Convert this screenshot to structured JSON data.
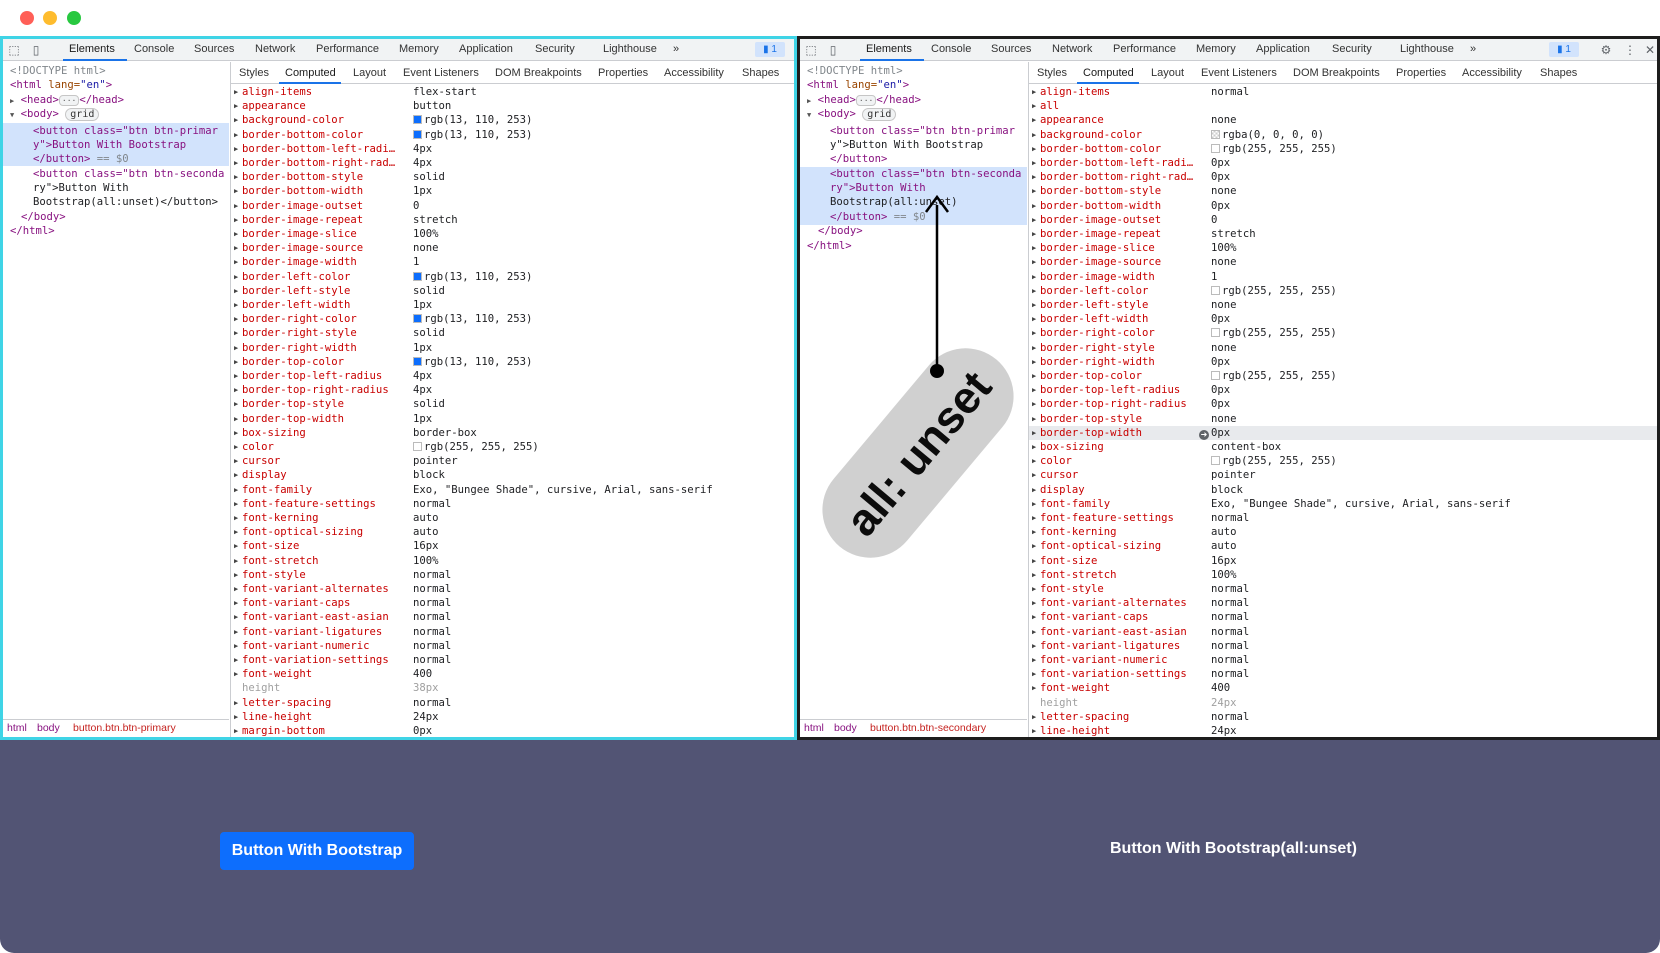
{
  "devtools_left": {
    "main_tabs": [
      "Elements",
      "Console",
      "Sources",
      "Network",
      "Performance",
      "Memory",
      "Application",
      "Security",
      "Lighthouse"
    ],
    "more_tabs": "»",
    "issues_count": "1",
    "dom": {
      "doctype": "<!DOCTYPE html>",
      "html_open_tag": "<html",
      "html_lang_attr": " lang=",
      "html_lang_val": "\"en\"",
      "html_open_close": ">",
      "head_open": "<head>",
      "head_ellipsis": "···",
      "head_close": "</head>",
      "body_open": "<body>",
      "body_badge": "grid",
      "button1_line1": "<button class=\"btn btn-primar",
      "button1_line2": "y\">Button With Bootstrap",
      "button1_line3": "</button>",
      "button1_eq": "== $0",
      "button2_line1": "<button class=\"btn btn-seconda",
      "button2_line2": "ry\">Button With",
      "button2_line3": "Bootstrap(all:unset)</button>",
      "body_close": "</body>",
      "html_close": "</html>"
    },
    "breadcrumbs": [
      "html",
      "body",
      "button.btn.btn-primary"
    ],
    "sub_tabs": [
      "Styles",
      "Computed",
      "Layout",
      "Event Listeners",
      "DOM Breakpoints",
      "Properties",
      "Accessibility",
      "Shapes"
    ],
    "active_sub_tab": "Computed",
    "computed": [
      {
        "name": "align-items",
        "value": "flex-start"
      },
      {
        "name": "appearance",
        "value": "button"
      },
      {
        "name": "background-color",
        "value": "rgb(13, 110, 253)",
        "swatch": "#0d6efd"
      },
      {
        "name": "border-bottom-color",
        "value": "rgb(13, 110, 253)",
        "swatch": "#0d6efd"
      },
      {
        "name": "border-bottom-left-radi…",
        "value": "4px"
      },
      {
        "name": "border-bottom-right-rad…",
        "value": "4px"
      },
      {
        "name": "border-bottom-style",
        "value": "solid"
      },
      {
        "name": "border-bottom-width",
        "value": "1px"
      },
      {
        "name": "border-image-outset",
        "value": "0"
      },
      {
        "name": "border-image-repeat",
        "value": "stretch"
      },
      {
        "name": "border-image-slice",
        "value": "100%"
      },
      {
        "name": "border-image-source",
        "value": "none"
      },
      {
        "name": "border-image-width",
        "value": "1"
      },
      {
        "name": "border-left-color",
        "value": "rgb(13, 110, 253)",
        "swatch": "#0d6efd"
      },
      {
        "name": "border-left-style",
        "value": "solid"
      },
      {
        "name": "border-left-width",
        "value": "1px"
      },
      {
        "name": "border-right-color",
        "value": "rgb(13, 110, 253)",
        "swatch": "#0d6efd"
      },
      {
        "name": "border-right-style",
        "value": "solid"
      },
      {
        "name": "border-right-width",
        "value": "1px"
      },
      {
        "name": "border-top-color",
        "value": "rgb(13, 110, 253)",
        "swatch": "#0d6efd"
      },
      {
        "name": "border-top-left-radius",
        "value": "4px"
      },
      {
        "name": "border-top-right-radius",
        "value": "4px"
      },
      {
        "name": "border-top-style",
        "value": "solid"
      },
      {
        "name": "border-top-width",
        "value": "1px"
      },
      {
        "name": "box-sizing",
        "value": "border-box"
      },
      {
        "name": "color",
        "value": "rgb(255, 255, 255)",
        "swatch": "#ffffff"
      },
      {
        "name": "cursor",
        "value": "pointer"
      },
      {
        "name": "display",
        "value": "block"
      },
      {
        "name": "font-family",
        "value": "Exo, \"Bungee Shade\", cursive, Arial, sans-serif"
      },
      {
        "name": "font-feature-settings",
        "value": "normal"
      },
      {
        "name": "font-kerning",
        "value": "auto"
      },
      {
        "name": "font-optical-sizing",
        "value": "auto"
      },
      {
        "name": "font-size",
        "value": "16px"
      },
      {
        "name": "font-stretch",
        "value": "100%"
      },
      {
        "name": "font-style",
        "value": "normal"
      },
      {
        "name": "font-variant-alternates",
        "value": "normal"
      },
      {
        "name": "font-variant-caps",
        "value": "normal"
      },
      {
        "name": "font-variant-east-asian",
        "value": "normal"
      },
      {
        "name": "font-variant-ligatures",
        "value": "normal"
      },
      {
        "name": "font-variant-numeric",
        "value": "normal"
      },
      {
        "name": "font-variation-settings",
        "value": "normal"
      },
      {
        "name": "font-weight",
        "value": "400"
      },
      {
        "name": "height",
        "value": "38px",
        "inherited": true
      },
      {
        "name": "letter-spacing",
        "value": "normal"
      },
      {
        "name": "line-height",
        "value": "24px"
      },
      {
        "name": "margin-bottom",
        "value": "0px"
      }
    ]
  },
  "devtools_right": {
    "main_tabs": [
      "Elements",
      "Console",
      "Sources",
      "Network",
      "Performance",
      "Memory",
      "Application",
      "Security",
      "Lighthouse"
    ],
    "more_tabs": "»",
    "issues_count": "1",
    "dom": {
      "doctype": "<!DOCTYPE html>",
      "html_open_tag": "<html",
      "html_lang_attr": " lang=",
      "html_lang_val": "\"en\"",
      "html_open_close": ">",
      "head_open": "<head>",
      "head_ellipsis": "···",
      "head_close": "</head>",
      "body_open": "<body>",
      "body_badge": "grid",
      "button1_line1": "<button class=\"btn btn-primar",
      "button1_line2": "y\">Button With Bootstrap",
      "button1_line3": "</button>",
      "button2_line1": "<button class=\"btn btn-seconda",
      "button2_line2": "ry\">Button With",
      "button2_line3": "Bootstrap(all:unset)",
      "button2_line4": "</button>",
      "button2_eq": "== $0",
      "body_close": "</body>",
      "html_close": "</html>"
    },
    "breadcrumbs": [
      "html",
      "body",
      "button.btn.btn-secondary"
    ],
    "sub_tabs": [
      "Styles",
      "Computed",
      "Layout",
      "Event Listeners",
      "DOM Breakpoints",
      "Properties",
      "Accessibility",
      "Shapes"
    ],
    "active_sub_tab": "Computed",
    "computed": [
      {
        "name": "align-items",
        "value": "normal"
      },
      {
        "name": "all",
        "value": ""
      },
      {
        "name": "appearance",
        "value": "none"
      },
      {
        "name": "background-color",
        "value": "rgba(0, 0, 0, 0)",
        "swatch": "transparent"
      },
      {
        "name": "border-bottom-color",
        "value": "rgb(255, 255, 255)",
        "swatch": "#ffffff"
      },
      {
        "name": "border-bottom-left-radi…",
        "value": "0px"
      },
      {
        "name": "border-bottom-right-rad…",
        "value": "0px"
      },
      {
        "name": "border-bottom-style",
        "value": "none"
      },
      {
        "name": "border-bottom-width",
        "value": "0px"
      },
      {
        "name": "border-image-outset",
        "value": "0"
      },
      {
        "name": "border-image-repeat",
        "value": "stretch"
      },
      {
        "name": "border-image-slice",
        "value": "100%"
      },
      {
        "name": "border-image-source",
        "value": "none"
      },
      {
        "name": "border-image-width",
        "value": "1"
      },
      {
        "name": "border-left-color",
        "value": "rgb(255, 255, 255)",
        "swatch": "#ffffff"
      },
      {
        "name": "border-left-style",
        "value": "none"
      },
      {
        "name": "border-left-width",
        "value": "0px"
      },
      {
        "name": "border-right-color",
        "value": "rgb(255, 255, 255)",
        "swatch": "#ffffff"
      },
      {
        "name": "border-right-style",
        "value": "none"
      },
      {
        "name": "border-right-width",
        "value": "0px"
      },
      {
        "name": "border-top-color",
        "value": "rgb(255, 255, 255)",
        "swatch": "#ffffff"
      },
      {
        "name": "border-top-left-radius",
        "value": "0px"
      },
      {
        "name": "border-top-right-radius",
        "value": "0px"
      },
      {
        "name": "border-top-style",
        "value": "none"
      },
      {
        "name": "border-top-width",
        "value": "0px",
        "highlighted": true
      },
      {
        "name": "box-sizing",
        "value": "content-box"
      },
      {
        "name": "color",
        "value": "rgb(255, 255, 255)",
        "swatch": "#ffffff"
      },
      {
        "name": "cursor",
        "value": "pointer"
      },
      {
        "name": "display",
        "value": "block"
      },
      {
        "name": "font-family",
        "value": "Exo, \"Bungee Shade\", cursive, Arial, sans-serif"
      },
      {
        "name": "font-feature-settings",
        "value": "normal"
      },
      {
        "name": "font-kerning",
        "value": "auto"
      },
      {
        "name": "font-optical-sizing",
        "value": "auto"
      },
      {
        "name": "font-size",
        "value": "16px"
      },
      {
        "name": "font-stretch",
        "value": "100%"
      },
      {
        "name": "font-style",
        "value": "normal"
      },
      {
        "name": "font-variant-alternates",
        "value": "normal"
      },
      {
        "name": "font-variant-caps",
        "value": "normal"
      },
      {
        "name": "font-variant-east-asian",
        "value": "normal"
      },
      {
        "name": "font-variant-ligatures",
        "value": "normal"
      },
      {
        "name": "font-variant-numeric",
        "value": "normal"
      },
      {
        "name": "font-variation-settings",
        "value": "normal"
      },
      {
        "name": "font-weight",
        "value": "400"
      },
      {
        "name": "height",
        "value": "24px",
        "inherited": true
      },
      {
        "name": "letter-spacing",
        "value": "normal"
      },
      {
        "name": "line-height",
        "value": "24px"
      }
    ]
  },
  "annotation": {
    "label": "all: unset"
  },
  "preview": {
    "primary_button_label": "Button With Bootstrap",
    "unset_button_label": "Button With Bootstrap(all:unset)"
  },
  "colors": {
    "accent": "#1a73e8",
    "bootstrap_primary": "#0d6efd",
    "preview_bg": "#525474",
    "left_panel_border": "#3fd4e6",
    "right_panel_border": "#1d1d1d",
    "traffic_red": "#ff5f57",
    "traffic_yellow": "#febc2e",
    "traffic_green": "#28c840"
  }
}
